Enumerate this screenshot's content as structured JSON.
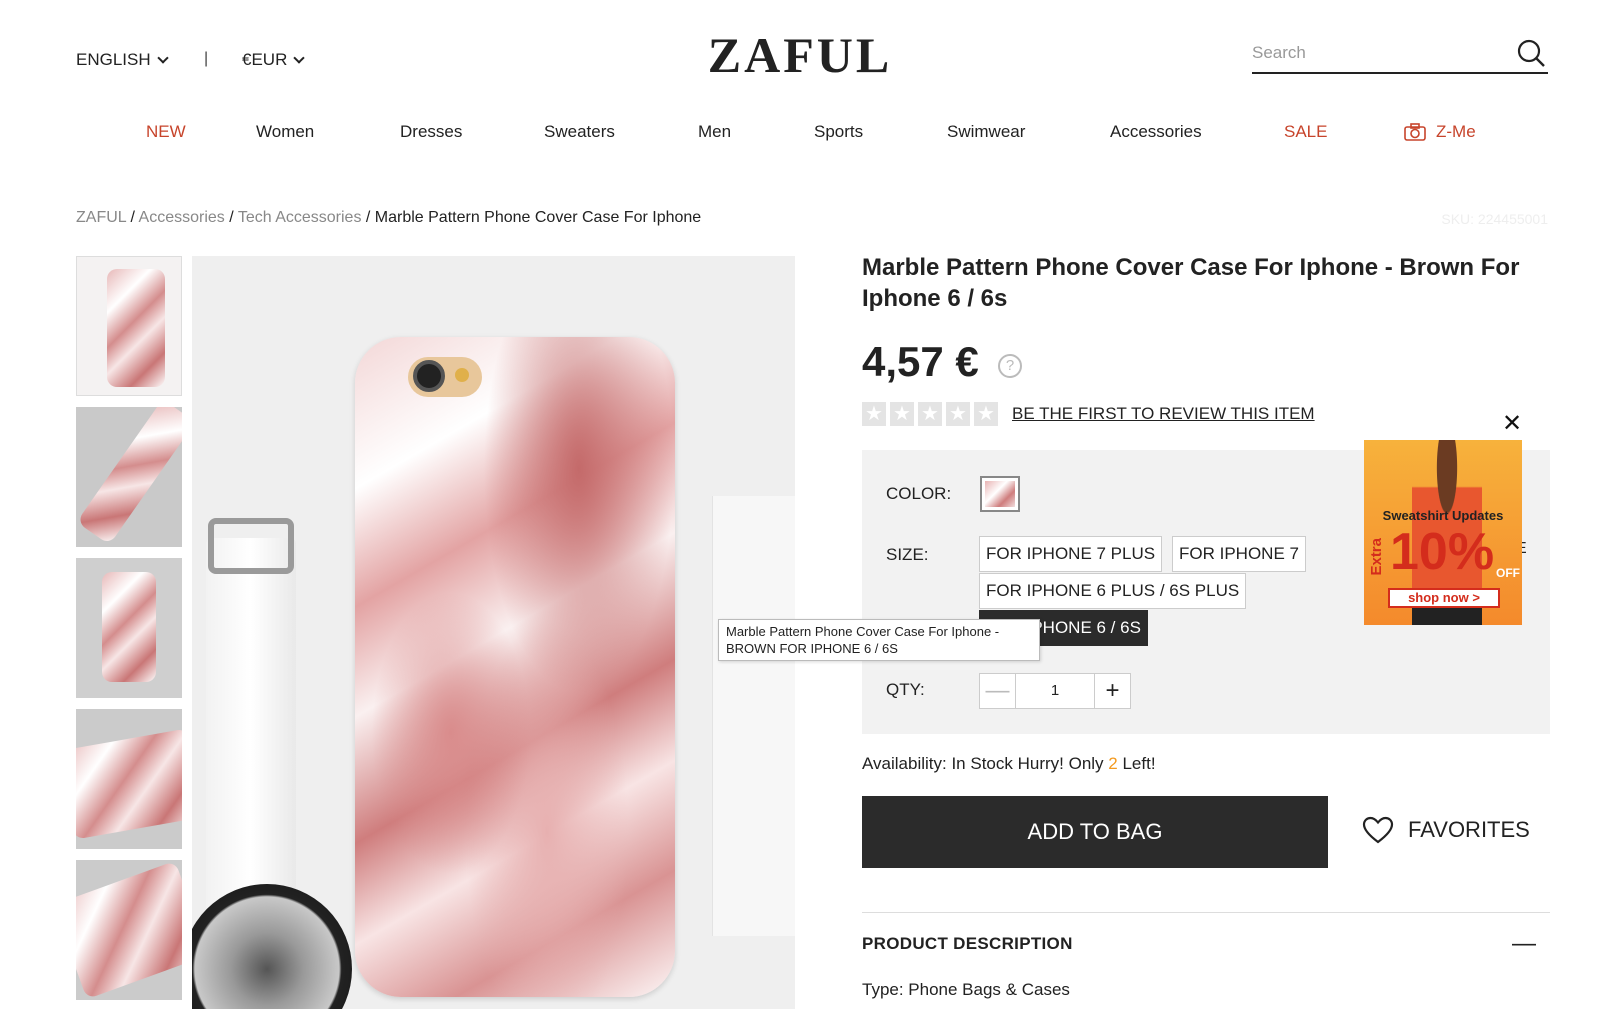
{
  "header": {
    "language": "ENGLISH",
    "separator": "|",
    "currency": "€EUR",
    "logo": "ZAFUL",
    "search_placeholder": "Search"
  },
  "nav": [
    {
      "label": "NEW",
      "color": "#c7442b"
    },
    {
      "label": "Women"
    },
    {
      "label": "Dresses"
    },
    {
      "label": "Sweaters"
    },
    {
      "label": "Men"
    },
    {
      "label": "Sports"
    },
    {
      "label": "Swimwear"
    },
    {
      "label": "Accessories"
    },
    {
      "label": "SALE",
      "color": "#c7442b"
    },
    {
      "label": "Z-Me",
      "icon": "camera-icon",
      "color": "#c7442b"
    }
  ],
  "breadcrumb": {
    "items": [
      "ZAFUL",
      "Accessories",
      "Tech Accessories"
    ],
    "current": "Marble Pattern Phone Cover Case For Iphone",
    "sep": " / "
  },
  "sku": "SKU: 224455001",
  "product": {
    "title": "Marble Pattern Phone Cover Case For Iphone - Brown For Iphone 6 / 6s",
    "price": "4,57 €",
    "help": "?",
    "review_link": "BE THE FIRST TO REVIEW THIS ITEM",
    "rating_stars": 0,
    "options": {
      "color_label": "COLOR:",
      "size_label": "SIZE:",
      "sizes": [
        "FOR IPHONE 7 PLUS",
        "FOR IPHONE 7",
        "FOR IPHONE 6 PLUS / 6S PLUS",
        "FOR IPHONE 6 / 6S"
      ],
      "selected_size": "FOR IPHONE 6 / 6S",
      "qty_label": "QTY:",
      "qty_value": "1",
      "qty_minus": "—",
      "qty_plus": "+"
    },
    "availability_prefix": "Availability: In Stock Hurry! Only ",
    "availability_count": "2",
    "availability_suffix": " Left!",
    "add_to_bag": "ADD TO BAG",
    "favorites": "FAVORITES",
    "description_title": "PRODUCT DESCRIPTION",
    "description_toggle": "—",
    "type_line": "Type: Phone Bags & Cases"
  },
  "tooltip": {
    "line1": "Marble Pattern Phone Cover Case For Iphone -",
    "line2": "BROWN FOR IPHONE 6 / 6S"
  },
  "ad": {
    "title": "Sweatshirt Updates",
    "extra": "Extra",
    "percent": "10%",
    "off": "OFF",
    "button": "shop now >",
    "close": "✕",
    "fragment": "E"
  },
  "colors": {
    "accent_red": "#c7442b",
    "button_dark": "#2b2b2b",
    "stock_orange": "#f39a1f"
  }
}
